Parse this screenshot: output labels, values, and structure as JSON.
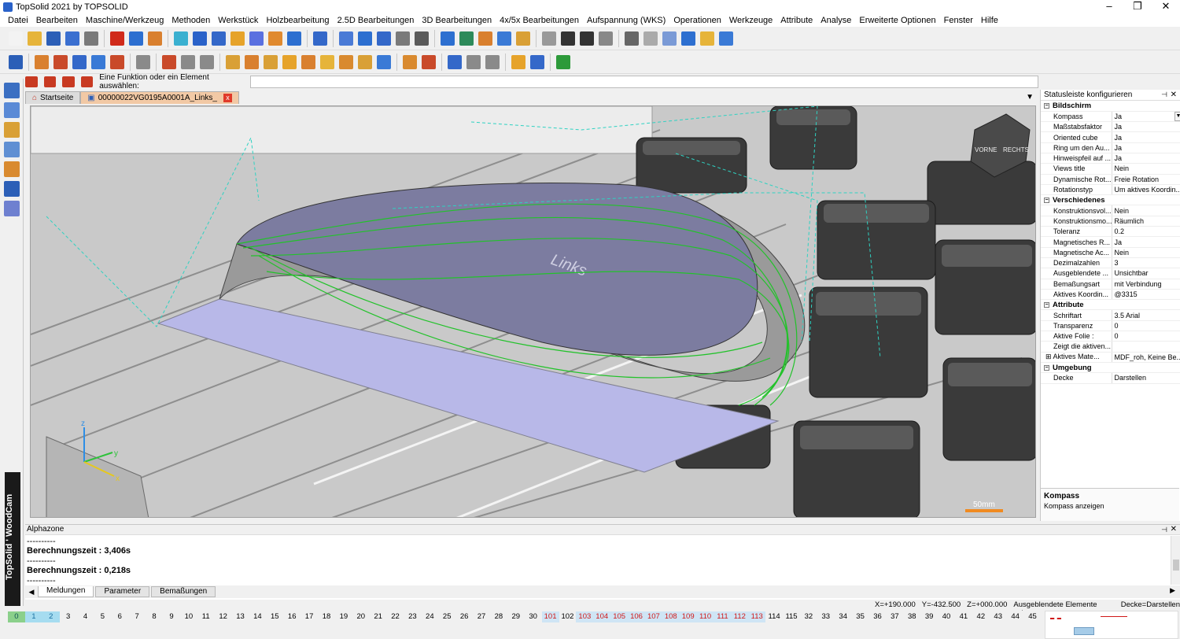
{
  "window": {
    "title": "TopSolid 2021 by TOPSOLID"
  },
  "menu": [
    "Datei",
    "Bearbeiten",
    "Maschine/Werkzeug",
    "Methoden",
    "Werkstück",
    "Holzbearbeitung",
    "2.5D Bearbeitungen",
    "3D Bearbeitungen",
    "4x/5x Bearbeitungen",
    "Aufspannung (WKS)",
    "Operationen",
    "Werkzeuge",
    "Attribute",
    "Analyse",
    "Erweiterte Optionen",
    "Fenster",
    "Hilfe"
  ],
  "command": {
    "prompt": "Eine Funktion oder ein Element auswählen:",
    "value": ""
  },
  "tabs": [
    {
      "label": "Startseite"
    },
    {
      "label": "00000022VG0195A0001A_Links_"
    }
  ],
  "viewport": {
    "surface_text": "Links",
    "scale_label": "50mm",
    "axes": {
      "z": "z",
      "y": "y",
      "x": "x"
    },
    "cube_labels": [
      "VORNE",
      "RECHTS"
    ]
  },
  "statusbar_panel": {
    "title": "Statusleiste konfigurieren",
    "sections": [
      {
        "name": "Bildschirm",
        "rows": [
          {
            "k": "Kompass",
            "v": "Ja"
          },
          {
            "k": "Maßstabsfaktor",
            "v": "Ja"
          },
          {
            "k": "Oriented cube",
            "v": "Ja"
          },
          {
            "k": "Ring um den Au...",
            "v": "Ja"
          },
          {
            "k": "Hinweispfeil auf ...",
            "v": "Ja"
          },
          {
            "k": "Views title",
            "v": "Nein"
          },
          {
            "k": "Dynamische Rot...",
            "v": "Freie Rotation"
          },
          {
            "k": "Rotationstyp",
            "v": "Um aktives Koordin..."
          }
        ]
      },
      {
        "name": "Verschiedenes",
        "rows": [
          {
            "k": "Konstruktionsvol...",
            "v": "Nein"
          },
          {
            "k": "Konstruktionsmo...",
            "v": "Räumlich"
          },
          {
            "k": "Toleranz",
            "v": "0.2"
          },
          {
            "k": "Magnetisches R...",
            "v": "Ja"
          },
          {
            "k": "Magnetische Ac...",
            "v": "Nein"
          },
          {
            "k": "Dezimalzahlen",
            "v": "3"
          },
          {
            "k": "Ausgeblendete ...",
            "v": "Unsichtbar"
          },
          {
            "k": "Bemaßungsart",
            "v": "mit Verbindung"
          },
          {
            "k": "Aktives Koordin...",
            "v": "@3315"
          }
        ]
      },
      {
        "name": "Attribute",
        "rows": [
          {
            "k": "Schriftart",
            "v": "3.5  Arial"
          },
          {
            "k": "Transparenz",
            "v": "0"
          },
          {
            "k": "Aktive Folie :",
            "v": "0"
          },
          {
            "k": "Zeigt die aktiven...",
            "v": ""
          },
          {
            "k": "Aktives Mate...",
            "v": "MDF_roh, Keine Be..."
          }
        ]
      },
      {
        "name": "Umgebung",
        "rows": [
          {
            "k": "Decke",
            "v": "Darstellen"
          }
        ]
      }
    ],
    "help_title": "Kompass",
    "help_desc": "Kompass anzeigen"
  },
  "alphazone": {
    "title": "Alphazone",
    "log": [
      "----------",
      "Berechnungszeit : 3,406s",
      "----------",
      "Berechnungszeit : 0,218s",
      "----------"
    ],
    "tabs": [
      "Meldungen",
      "Parameter",
      "Bemaßungen"
    ]
  },
  "status": {
    "x": "X=+190.000",
    "y": "Y=-432.500",
    "z": "Z=+000.000",
    "hidden": "Ausgeblendete Elemente zeigen = aus",
    "ceiling": "Decke=Darstellen"
  },
  "layers": [
    "0",
    "1",
    "2",
    "3",
    "4",
    "5",
    "6",
    "7",
    "8",
    "9",
    "10",
    "11",
    "12",
    "13",
    "14",
    "15",
    "16",
    "17",
    "18",
    "19",
    "20",
    "21",
    "22",
    "23",
    "24",
    "25",
    "26",
    "27",
    "28",
    "29",
    "30",
    "101",
    "102",
    "103",
    "104",
    "105",
    "106",
    "107",
    "108",
    "109",
    "110",
    "111",
    "112",
    "113",
    "114",
    "115",
    "32",
    "33",
    "34",
    "35",
    "36",
    "37",
    "38",
    "39",
    "40",
    "41",
    "42",
    "43",
    "44",
    "45"
  ],
  "brand": "TopSolid ' WoodCam"
}
